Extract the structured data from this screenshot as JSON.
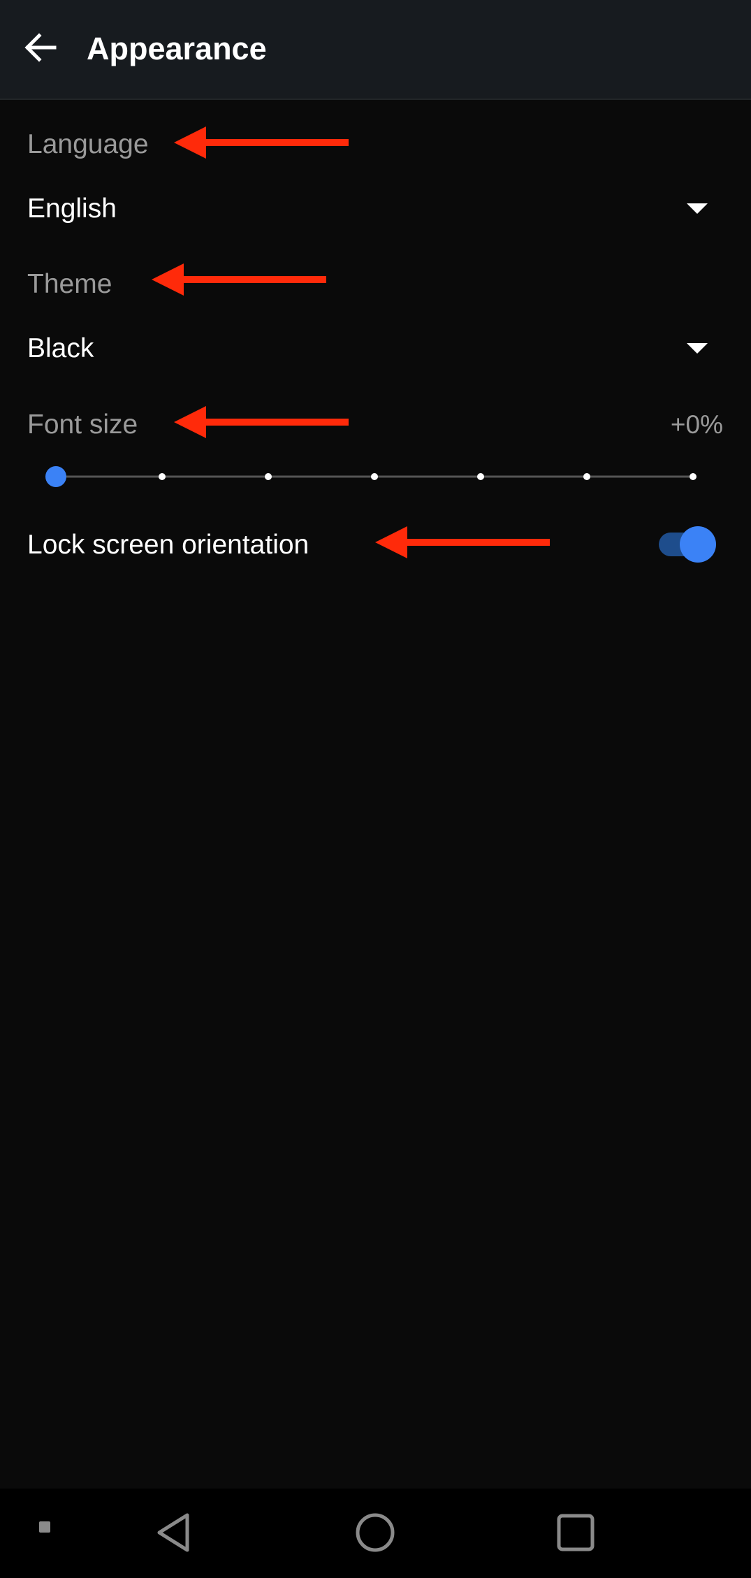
{
  "app_bar": {
    "title": "Appearance",
    "back_icon": "arrow-left-icon"
  },
  "settings": {
    "language": {
      "label": "Language",
      "value": "English"
    },
    "theme": {
      "label": "Theme",
      "value": "Black"
    },
    "font_size": {
      "label": "Font size",
      "value": "+0%",
      "slider_steps": 7,
      "slider_position": 0
    },
    "lock_orientation": {
      "label": "Lock screen orientation",
      "enabled": true
    }
  },
  "annotations": {
    "arrow_color": "#ff2a0a"
  },
  "colors": {
    "accent": "#3b82f6",
    "background": "#0a0a0a",
    "app_bar": "#171b1f"
  },
  "nav_bar": {
    "icons": [
      "square-dot-icon",
      "back-triangle-icon",
      "home-circle-icon",
      "recents-square-icon"
    ]
  }
}
